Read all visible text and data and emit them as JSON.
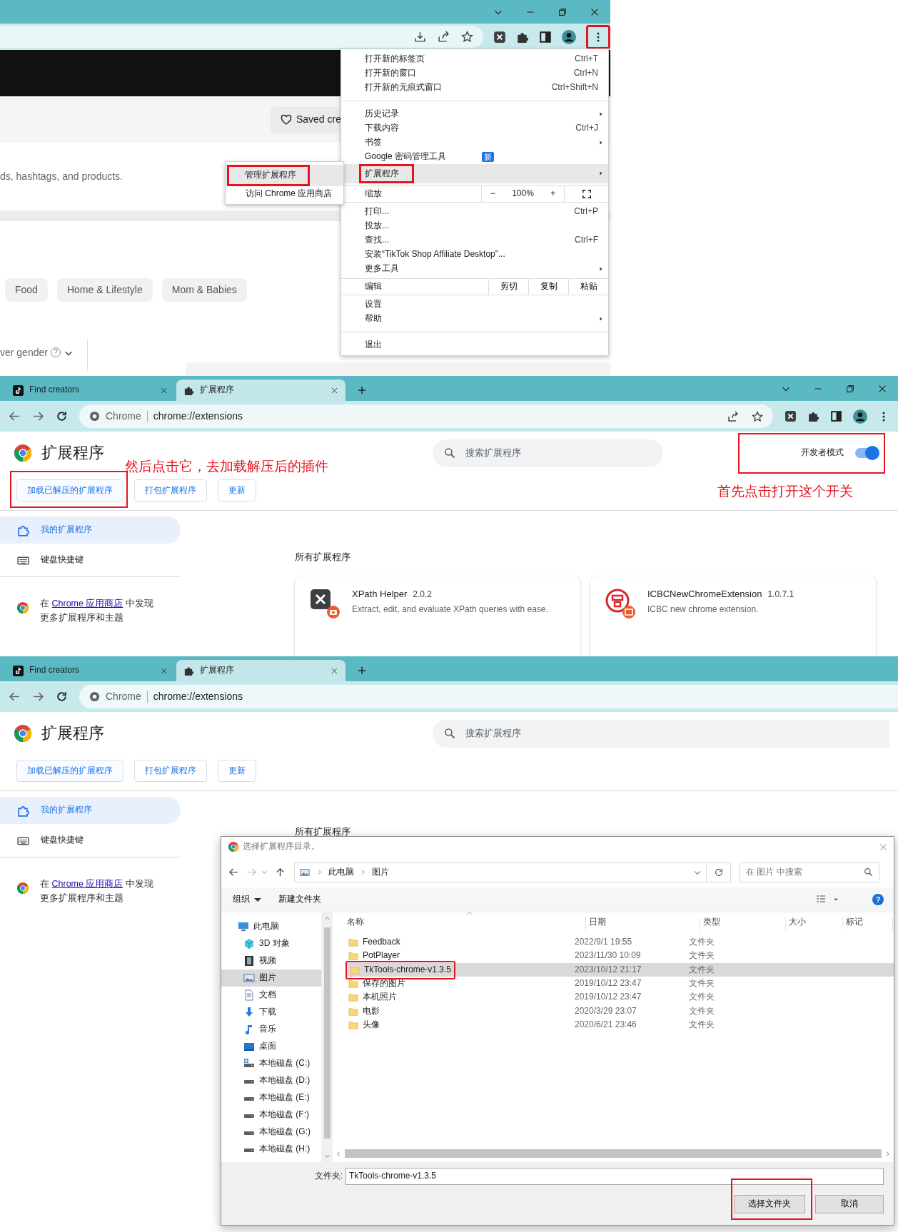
{
  "panel_1": {
    "menu_button": {
      "highlighted": true
    },
    "saved_button": "Saved cre",
    "search_hint": "ds, hashtags, and products.",
    "chips": [
      "Food",
      "Home & Lifestyle",
      "Mom & Babies"
    ],
    "filter": {
      "label": "ver gender",
      "help": "?"
    },
    "submenu": [
      {
        "label": "管理扩展程序",
        "selected": true,
        "highlighted": true
      },
      {
        "label": "访问 Chrome 应用商店",
        "selected": false
      }
    ],
    "menu": [
      {
        "kind": "item",
        "label": "打开新的标签页",
        "shortcut": "Ctrl+T",
        "submenu": false,
        "selected": false
      },
      {
        "kind": "item",
        "label": "打开新的窗口",
        "shortcut": "Ctrl+N",
        "submenu": false,
        "selected": false
      },
      {
        "kind": "item",
        "label": "打开新的无痕式窗口",
        "shortcut": "Ctrl+Shift+N",
        "submenu": false,
        "selected": false
      },
      {
        "kind": "separator"
      },
      {
        "kind": "item",
        "label": "历史记录",
        "submenu": true,
        "selected": false
      },
      {
        "kind": "item",
        "label": "下载内容",
        "shortcut": "Ctrl+J",
        "submenu": false,
        "selected": false
      },
      {
        "kind": "item",
        "label": "书签",
        "submenu": true,
        "selected": false
      },
      {
        "kind": "item",
        "label": "Google 密码管理工具",
        "badge": "新",
        "submenu": false,
        "selected": false
      },
      {
        "kind": "item",
        "label": "扩展程序",
        "submenu": true,
        "selected": true,
        "highlighted": true
      },
      {
        "kind": "zoom",
        "label": "缩放",
        "minus": "−",
        "value": "100%",
        "plus": "+"
      },
      {
        "kind": "item",
        "label": "打印...",
        "shortcut": "Ctrl+P",
        "submenu": false,
        "selected": false
      },
      {
        "kind": "item",
        "label": "投放...",
        "submenu": false,
        "selected": false
      },
      {
        "kind": "item",
        "label": "查找...",
        "shortcut": "Ctrl+F",
        "submenu": false,
        "selected": false
      },
      {
        "kind": "item",
        "label": "安装“TikTok Shop Affiliate Desktop”...",
        "submenu": false,
        "selected": false
      },
      {
        "kind": "item",
        "label": "更多工具",
        "submenu": true,
        "selected": false
      },
      {
        "kind": "edit",
        "label": "编辑",
        "actions": [
          "剪切",
          "复制",
          "粘贴"
        ]
      },
      {
        "kind": "item",
        "label": "设置",
        "submenu": false,
        "selected": false
      },
      {
        "kind": "item",
        "label": "帮助",
        "submenu": true,
        "selected": false
      },
      {
        "kind": "separator"
      },
      {
        "kind": "item",
        "label": "退出",
        "submenu": false,
        "selected": false
      }
    ]
  },
  "panel_2": {
    "tabs": [
      {
        "label": "Find creators",
        "kind": "tiktok",
        "selected": false
      },
      {
        "label": "扩展程序",
        "kind": "extensions",
        "selected": true
      }
    ],
    "omnibox": {
      "site": "Chrome",
      "url": "chrome://extensions"
    },
    "title": "扩展程序",
    "search": {
      "placeholder": "搜索扩展程序"
    },
    "developer_mode": {
      "label": "开发者模式",
      "on": true,
      "highlighted": true
    },
    "buttons": [
      {
        "label": "加载已解压的扩展程序",
        "highlighted": true
      },
      {
        "label": "打包扩展程序"
      },
      {
        "label": "更新"
      }
    ],
    "annotations": [
      "然后点击它，去加载解压后的插件",
      "首先点击打开这个开关"
    ],
    "sidebar": [
      {
        "label": "我的扩展程序",
        "kind": "extensions",
        "selected": true
      },
      {
        "label": "键盘快捷键",
        "kind": "keyboard",
        "selected": false
      }
    ],
    "store_promo": {
      "prefix": "在 ",
      "link": "Chrome 应用商店",
      "suffix": " 中发现",
      "line_2": "更多扩展程序和主题"
    },
    "section_title": "所有扩展程序",
    "extensions": [
      {
        "name": "XPath Helper",
        "version": "2.0.2",
        "kind": "xpath",
        "description": "Extract, edit, and evaluate XPath queries with ease."
      },
      {
        "name": "ICBCNewChromeExtension",
        "version": "1.0.7.1",
        "kind": "icbc",
        "description": "ICBC new chrome extension."
      }
    ]
  },
  "panel_3": {
    "tabs": [
      {
        "label": "Find creators",
        "kind": "tiktok",
        "selected": false
      },
      {
        "label": "扩展程序",
        "kind": "extensions",
        "selected": true
      }
    ],
    "omnibox": {
      "site": "Chrome",
      "url": "chrome://extensions"
    },
    "title": "扩展程序",
    "search": {
      "placeholder": "搜索扩展程序"
    },
    "buttons": [
      {
        "label": "加载已解压的扩展程序"
      },
      {
        "label": "打包扩展程序"
      },
      {
        "label": "更新"
      }
    ],
    "sidebar": [
      {
        "label": "我的扩展程序",
        "kind": "extensions",
        "selected": true
      },
      {
        "label": "键盘快捷键",
        "kind": "keyboard",
        "selected": false
      }
    ],
    "store_promo": {
      "prefix": "在 ",
      "link": "Chrome 应用商店",
      "suffix": " 中发现",
      "line_2": "更多扩展程序和主题"
    },
    "section_title": "所有扩展程序",
    "dialog": {
      "title": "选择扩展程序目录。",
      "path": [
        "此电脑",
        "图片"
      ],
      "search": {
        "placeholder": "在 图片 中搜索"
      },
      "toolbar": [
        {
          "label": "组织",
          "dropdown": true
        },
        {
          "label": "新建文件夹",
          "dropdown": false
        }
      ],
      "help": "?",
      "nav_tree": [
        {
          "label": "此电脑",
          "kind": "pc",
          "selected": false,
          "children": [
            {
              "label": "3D 对象",
              "kind": "objects",
              "selected": false
            },
            {
              "label": "视频",
              "kind": "videos",
              "selected": false
            },
            {
              "label": "图片",
              "kind": "pictures",
              "selected": true
            },
            {
              "label": "文档",
              "kind": "documents",
              "selected": false
            },
            {
              "label": "下载",
              "kind": "downloads",
              "selected": false
            },
            {
              "label": "音乐",
              "kind": "music",
              "selected": false
            },
            {
              "label": "桌面",
              "kind": "desktop",
              "selected": false
            },
            {
              "label": "本地磁盘 (C:)",
              "kind": "system_drive",
              "selected": false
            },
            {
              "label": "本地磁盘 (D:)",
              "kind": "drive",
              "selected": false
            },
            {
              "label": "本地磁盘 (E:)",
              "kind": "drive",
              "selected": false
            },
            {
              "label": "本地磁盘 (F:)",
              "kind": "drive",
              "selected": false
            },
            {
              "label": "本地磁盘 (G:)",
              "kind": "drive",
              "selected": false
            },
            {
              "label": "本地磁盘 (H:)",
              "kind": "drive",
              "selected": false
            }
          ]
        }
      ],
      "columns": [
        "名称",
        "日期",
        "类型",
        "大小",
        "标记"
      ],
      "files": [
        {
          "name": "Feedback",
          "date": "2022/9/1 19:55",
          "type": "文件夹",
          "selected": false
        },
        {
          "name": "PotPlayer",
          "date": "2023/11/30 10:09",
          "type": "文件夹",
          "selected": false
        },
        {
          "name": "TkTools-chrome-v1.3.5",
          "date": "2023/10/12 21:17",
          "type": "文件夹",
          "selected": true,
          "highlighted": true
        },
        {
          "name": "保存的图片",
          "date": "2019/10/12 23:47",
          "type": "文件夹",
          "selected": false
        },
        {
          "name": "本机照片",
          "date": "2019/10/12 23:47",
          "type": "文件夹",
          "selected": false
        },
        {
          "name": "电影",
          "date": "2020/3/29 23:07",
          "type": "文件夹",
          "selected": false
        },
        {
          "name": "头像",
          "date": "2020/6/21 23:46",
          "type": "文件夹",
          "selected": false
        }
      ],
      "folder_label": "文件夹:",
      "folder_value": "TkTools-chrome-v1.3.5",
      "buttons": [
        {
          "label": "选择文件夹",
          "highlighted": true
        },
        {
          "label": "取消"
        }
      ]
    }
  }
}
